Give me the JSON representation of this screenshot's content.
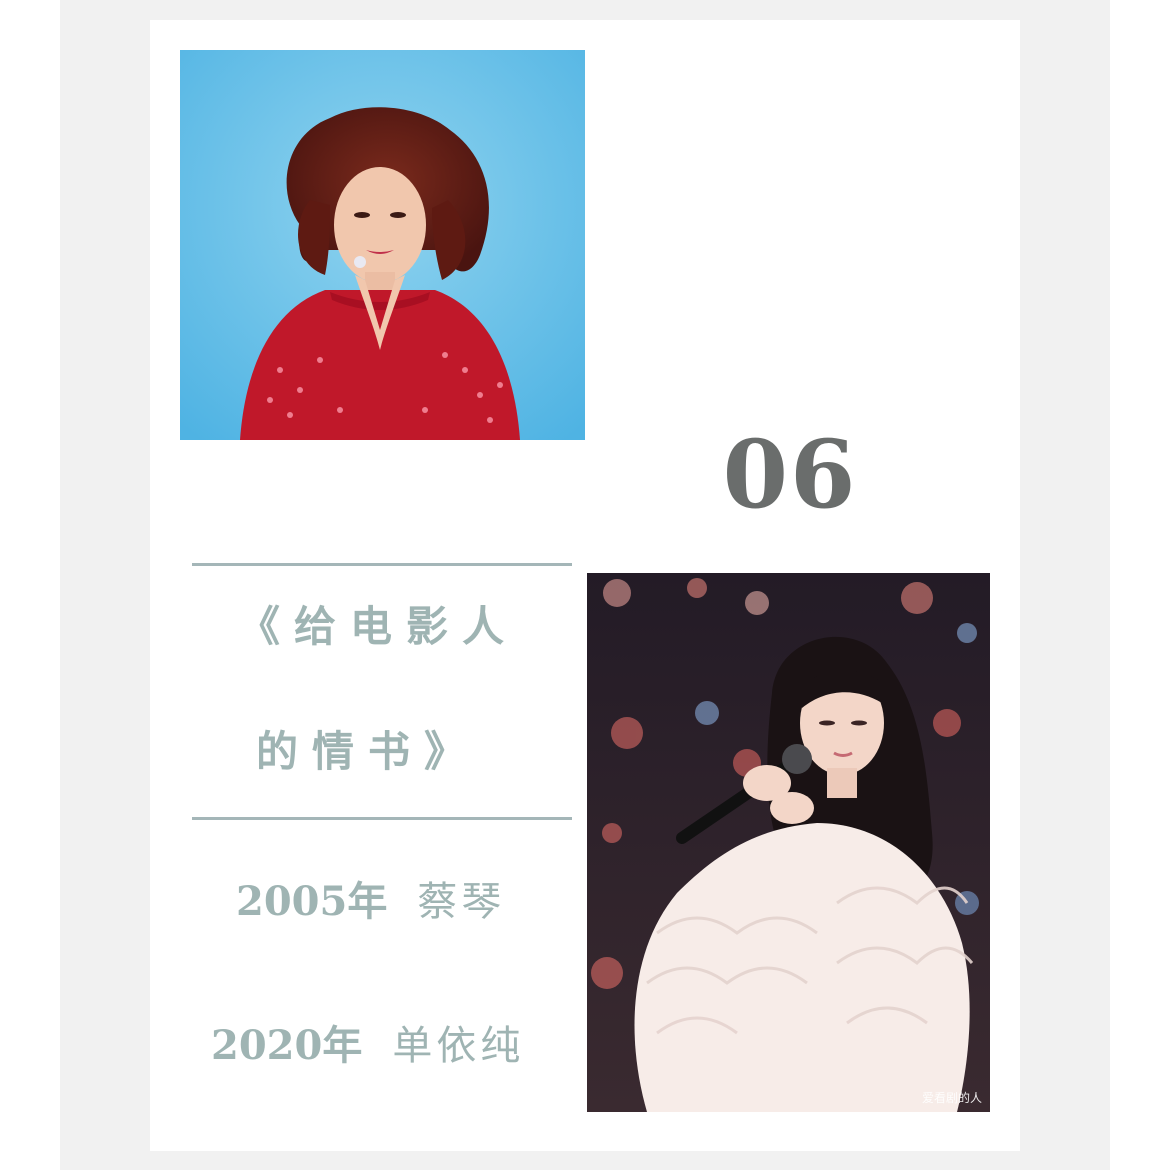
{
  "feature": {
    "number": "06",
    "song_title_line_1": "《给电影人",
    "song_title_line_2": "的情书》"
  },
  "credits": [
    {
      "year": "2005年",
      "artist": "蔡琴"
    },
    {
      "year": "2020年",
      "artist": "单依纯"
    }
  ],
  "photos": {
    "bottom_watermark": "爱看剧的人"
  },
  "colors": {
    "accent": "#9fb4b3",
    "rule": "#a4b6b8",
    "number": "#6a6d6c",
    "background_frame": "#f1f1f1",
    "card": "#ffffff"
  }
}
